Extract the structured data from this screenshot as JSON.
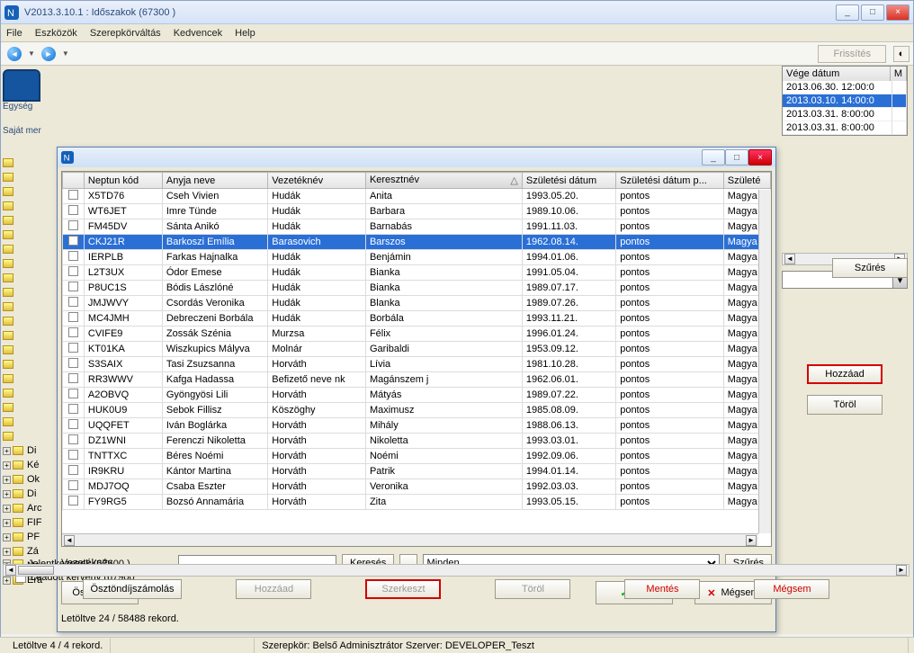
{
  "window": {
    "title": "V2013.3.10.1 : Időszakok (67300  )",
    "minimize": "_",
    "maximize": "□",
    "close": "×"
  },
  "menu": [
    "File",
    "Eszközök",
    "Szerepkörváltás",
    "Kedvencek",
    "Help"
  ],
  "toolbar": {
    "back": "←",
    "fwd": "→",
    "refresh": "Frissítés"
  },
  "left": {
    "egys": "Egység",
    "saj": "Saját mer"
  },
  "tree_labels": [
    "Di",
    "Ké",
    "Ok",
    "Di",
    "Arc",
    "FIF",
    "PF",
    "Zá",
    "Ne",
    "Era"
  ],
  "tree_bottom": {
    "jel": "Jelentkezesek (67600  )",
    "lead": "Leadott kérvény (67900"
  },
  "right": {
    "hdr": [
      "Vége dátum",
      "M"
    ],
    "rows": [
      [
        "2013.06.30. 12:00:0",
        ""
      ],
      [
        "2013.03.10. 14:00:0",
        ""
      ],
      [
        "2013.03.31. 8:00:00",
        ""
      ],
      [
        "2013.03.31. 8:00:00",
        ""
      ]
    ],
    "sel": 1,
    "szures": "Szűrés",
    "hozzaad": "Hozzáad",
    "torol": "Töröl"
  },
  "dialog": {
    "columns": [
      "",
      "Neptun kód",
      "Anyja neve",
      "Vezetéknév",
      "Keresztnév",
      "Születési dátum",
      "Születési dátum p...",
      "Születé"
    ],
    "sort_col": 4,
    "sort_dir": "△",
    "sel_row": 3,
    "rows": [
      [
        "X5TD76",
        "Cseh Vivien",
        "Hudák",
        "Anita",
        "1993.05.20.",
        "pontos",
        "Magya"
      ],
      [
        "WT6JET",
        "Imre Tünde",
        "Hudák",
        "Barbara",
        "1989.10.06.",
        "pontos",
        "Magya"
      ],
      [
        "FM45DV",
        "Sánta Anikó",
        "Hudák",
        "Barnabás",
        "1991.11.03.",
        "pontos",
        "Magya"
      ],
      [
        "CKJ21R",
        "Barkoszi Emília",
        "Barasovich",
        "Barszos",
        "1962.08.14.",
        "pontos",
        "Magya"
      ],
      [
        "IERPLB",
        "Farkas Hajnalka",
        "Hudák",
        "Benjámin",
        "1994.01.06.",
        "pontos",
        "Magya"
      ],
      [
        "L2T3UX",
        "Ódor Emese",
        "Hudák",
        "Bianka",
        "1991.05.04.",
        "pontos",
        "Magya"
      ],
      [
        "P8UC1S",
        "Bódis Lászlóné",
        "Hudák",
        "Bianka",
        "1989.07.17.",
        "pontos",
        "Magya"
      ],
      [
        "JMJWVY",
        "Csordás Veronika",
        "Hudák",
        "Blanka",
        "1989.07.26.",
        "pontos",
        "Magya"
      ],
      [
        "MC4JMH",
        "Debreczeni Borbála",
        "Hudák",
        "Borbála",
        "1993.11.21.",
        "pontos",
        "Magya"
      ],
      [
        "CVIFE9",
        "Zossák Szénia",
        "Murzsa",
        "Félix",
        "1996.01.24.",
        "pontos",
        "Magya"
      ],
      [
        "KT01KA",
        "Wiszkupics Mályva",
        "Molnár",
        "Garibaldi",
        "1953.09.12.",
        "pontos",
        "Magya"
      ],
      [
        "S3SAIX",
        "Tasi Zsuzsanna",
        "Horváth",
        "Lívia",
        "1981.10.28.",
        "pontos",
        "Magya"
      ],
      [
        "RR3WWV",
        "Kafga Hadassa",
        "Befizető neve nk",
        "Magánszem j",
        "1962.06.01.",
        "pontos",
        "Magya"
      ],
      [
        "A2OBVQ",
        "Gyöngyösi Lili",
        "Horváth",
        "Mátyás",
        "1989.07.22.",
        "pontos",
        "Magya"
      ],
      [
        "HUK0U9",
        "Sebok Fillisz",
        "Köszöghy",
        "Maximusz",
        "1985.08.09.",
        "pontos",
        "Magya"
      ],
      [
        "UQQFET",
        "Iván Boglárka",
        "Horváth",
        "Mihály",
        "1988.06.13.",
        "pontos",
        "Magya"
      ],
      [
        "DZ1WNI",
        "Ferenczi Nikoletta",
        "Horváth",
        "Nikoletta",
        "1993.03.01.",
        "pontos",
        "Magya"
      ],
      [
        "TNTTXC",
        "Béres Noémi",
        "Horváth",
        "Noémi",
        "1992.09.06.",
        "pontos",
        "Magya"
      ],
      [
        "IR9KRU",
        "Kántor Martina",
        "Horváth",
        "Patrik",
        "1994.01.14.",
        "pontos",
        "Magya"
      ],
      [
        "MDJ7OQ",
        "Csaba Eszter",
        "Horváth",
        "Veronika",
        "1992.03.03.",
        "pontos",
        "Magya"
      ],
      [
        "FY9RG5",
        "Bozsó Annamária",
        "Horváth",
        "Zita",
        "1993.05.15.",
        "pontos",
        "Magya"
      ]
    ],
    "search_label": "Vezetéknév",
    "search_placeholder": "",
    "keres": "Keresés",
    "dots": "...",
    "filter_value": "Minden",
    "szures": "Szűrés",
    "osszes": "Összes adat",
    "ok": "OK",
    "megsem": "Mégsem",
    "download": "Letöltve 24 / 58488 rekord."
  },
  "bottom": {
    "oszt": "Ösztöndíjszámolás",
    "hozzaad": "Hozzáad",
    "szerk": "Szerkeszt",
    "torol": "Töröl",
    "mentes": "Mentés",
    "megsem": "Mégsem"
  },
  "status": {
    "rec": "Letöltve 4 / 4 rekord.",
    "role": "Szerepkör: Belső Adminisztrátor  Szerver: DEVELOPER_Teszt"
  }
}
